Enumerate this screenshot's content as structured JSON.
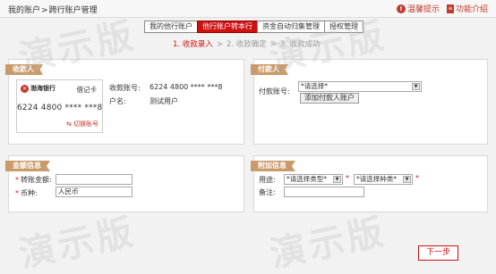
{
  "breadcrumb": {
    "root": "我的账户",
    "sep": ">",
    "current": "跨行账户管理"
  },
  "toplinks": {
    "tips": "温馨提示",
    "features": "功能介绍"
  },
  "tabs": [
    {
      "label": "我的他行账户"
    },
    {
      "label": "他行账户转本行"
    },
    {
      "label": "资金自动归集管理"
    },
    {
      "label": "授权管理"
    }
  ],
  "steps": [
    "1. 收款录入",
    "2. 收款确定",
    "3. 收款成功"
  ],
  "payee": {
    "title": "收款人",
    "card": {
      "bank_name": "渤海银行",
      "card_type": "借记卡",
      "number": "6224 4800 **** ***8",
      "switch_label": "切换账号"
    },
    "account_label": "收款账号:",
    "account_value": "6224 4800 **** ***8",
    "name_label": "户名:",
    "name_value": "测试用户"
  },
  "payer": {
    "title": "付款人",
    "account_label": "付款账号:",
    "account_select": "*请选择*",
    "add_button": "添加付款人账户"
  },
  "amount": {
    "title": "金额信息",
    "amount_label": "转账金额:",
    "amount_value": "",
    "currency_label": "币种:",
    "currency_value": "人民币"
  },
  "extra": {
    "title": "附加信息",
    "purpose_label": "用途:",
    "type_select": "*请选择类型*",
    "kind_select": "*请选择种类*",
    "remark_label": "备注:",
    "remark_value": ""
  },
  "next_button": "下一步",
  "watermark": "演示版",
  "colors": {
    "accent": "#cc1111",
    "panel_tag": "#c99b6b"
  }
}
